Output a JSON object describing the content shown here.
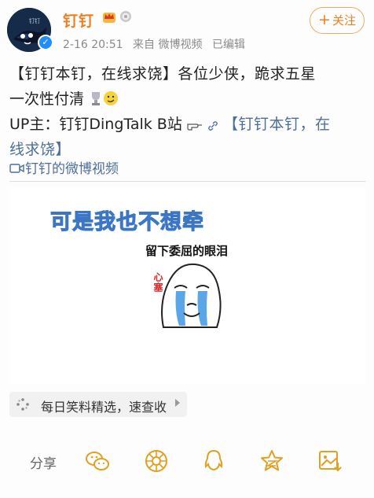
{
  "header": {
    "username": "钉钉",
    "avatar_text": "钉钉",
    "meta": {
      "date": "2-16 20:51",
      "source": "来自 微博视频",
      "edited": "已编辑"
    },
    "follow_label": "关注",
    "follow_plus": "+"
  },
  "post": {
    "line1": "【钉钉本钉，在线求饶】各位少侠，跪求五星",
    "line2": "一次性付清",
    "line3_prefix": "UP主：钉钉DingTalk B站",
    "line3_link": "【钉钉本钉，在",
    "line4_link": "线求饶】",
    "video_link": "钉钉的微博视频"
  },
  "media": {
    "title": "可是我也不想牵",
    "subtitle": "留下委屈的眼泪",
    "red_text": "心塞"
  },
  "sub_bar": {
    "label": "每日笑料精选，速查收"
  },
  "bottom": {
    "share_label": "分享",
    "icons": [
      "wechat-icon",
      "moments-icon",
      "qq-icon",
      "qzone-icon",
      "save-image-icon"
    ]
  },
  "colors": {
    "accent": "#e98124",
    "link": "#4e6e9a",
    "meta": "#8a8a8a",
    "meme_blue": "#4a8bd6",
    "share_icon": "#e0a020"
  }
}
